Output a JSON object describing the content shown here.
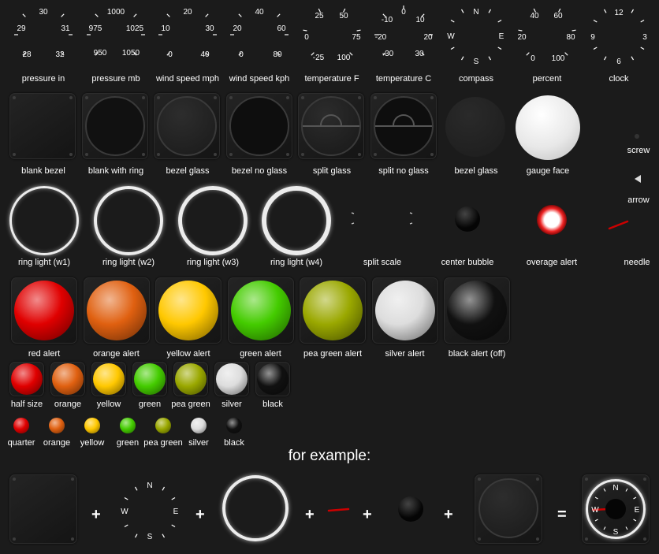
{
  "gauges": [
    {
      "label": "pressure in",
      "ticks": [
        "30",
        "29",
        "31",
        "28",
        "32"
      ]
    },
    {
      "label": "pressure mb",
      "ticks": [
        "1000",
        "975",
        "1025",
        "950",
        "1050"
      ]
    },
    {
      "label": "wind speed mph",
      "ticks": [
        "20",
        "10",
        "30",
        "0",
        "40"
      ]
    },
    {
      "label": "wind speed kph",
      "ticks": [
        "40",
        "20",
        "60",
        "0",
        "80"
      ]
    },
    {
      "label": "temperature F",
      "ticks": [
        "25",
        "50",
        "0",
        "75",
        "-25",
        "100"
      ]
    },
    {
      "label": "temperature C",
      "ticks": [
        "0",
        "-10",
        "10",
        "-20",
        "20",
        "-30",
        "30"
      ]
    },
    {
      "label": "compass",
      "ticks": [
        "N",
        "W",
        "E",
        "S"
      ]
    },
    {
      "label": "percent",
      "ticks": [
        "40",
        "60",
        "20",
        "80",
        "0",
        "100"
      ]
    },
    {
      "label": "clock",
      "ticks": [
        "12",
        "9",
        "3",
        "6"
      ]
    }
  ],
  "bezels": [
    {
      "label": "blank bezel"
    },
    {
      "label": "blank with ring"
    },
    {
      "label": "bezel glass"
    },
    {
      "label": "bezel no glass"
    },
    {
      "label": "split glass"
    },
    {
      "label": "split no glass"
    },
    {
      "label": "bezel glass"
    },
    {
      "label": "gauge face"
    },
    {
      "label": "screw"
    },
    {
      "label": "arrow"
    }
  ],
  "rings": [
    {
      "label": "ring light (w1)"
    },
    {
      "label": "ring light (w2)"
    },
    {
      "label": "ring light (w3)"
    },
    {
      "label": "ring light (w4)"
    },
    {
      "label": "split scale"
    },
    {
      "label": "center bubble"
    },
    {
      "label": "overage alert"
    },
    {
      "label": "needle"
    }
  ],
  "alerts_large": [
    {
      "label": "red alert",
      "color": "#e00000"
    },
    {
      "label": "orange alert",
      "color": "#e06010"
    },
    {
      "label": "yellow alert",
      "color": "#ffc800"
    },
    {
      "label": "green alert",
      "color": "#44cc00"
    },
    {
      "label": "pea green alert",
      "color": "#9aa800"
    },
    {
      "label": "silver alert",
      "color": "#dddddd"
    },
    {
      "label": "black alert (off)",
      "color": "#111111"
    }
  ],
  "alerts_half": [
    {
      "label": "half size",
      "color": "#e00000"
    },
    {
      "label": "orange",
      "color": "#e06010"
    },
    {
      "label": "yellow",
      "color": "#ffc800"
    },
    {
      "label": "green",
      "color": "#44cc00"
    },
    {
      "label": "pea green",
      "color": "#9aa800"
    },
    {
      "label": "silver",
      "color": "#dddddd"
    },
    {
      "label": "black",
      "color": "#111111"
    }
  ],
  "alerts_quarter": [
    {
      "label": "quarter",
      "color": "#e00000"
    },
    {
      "label": "orange",
      "color": "#e06010"
    },
    {
      "label": "yellow",
      "color": "#ffc800"
    },
    {
      "label": "green",
      "color": "#44cc00"
    },
    {
      "label": "pea green",
      "color": "#9aa800"
    },
    {
      "label": "silver",
      "color": "#dddddd"
    },
    {
      "label": "black",
      "color": "#111111"
    }
  ],
  "example": {
    "title": "for example:",
    "plus": "+",
    "equals": "=",
    "compass_ticks": [
      "N",
      "W",
      "E",
      "S"
    ],
    "result_ticks": [
      "N",
      "W",
      "E",
      "S"
    ]
  }
}
